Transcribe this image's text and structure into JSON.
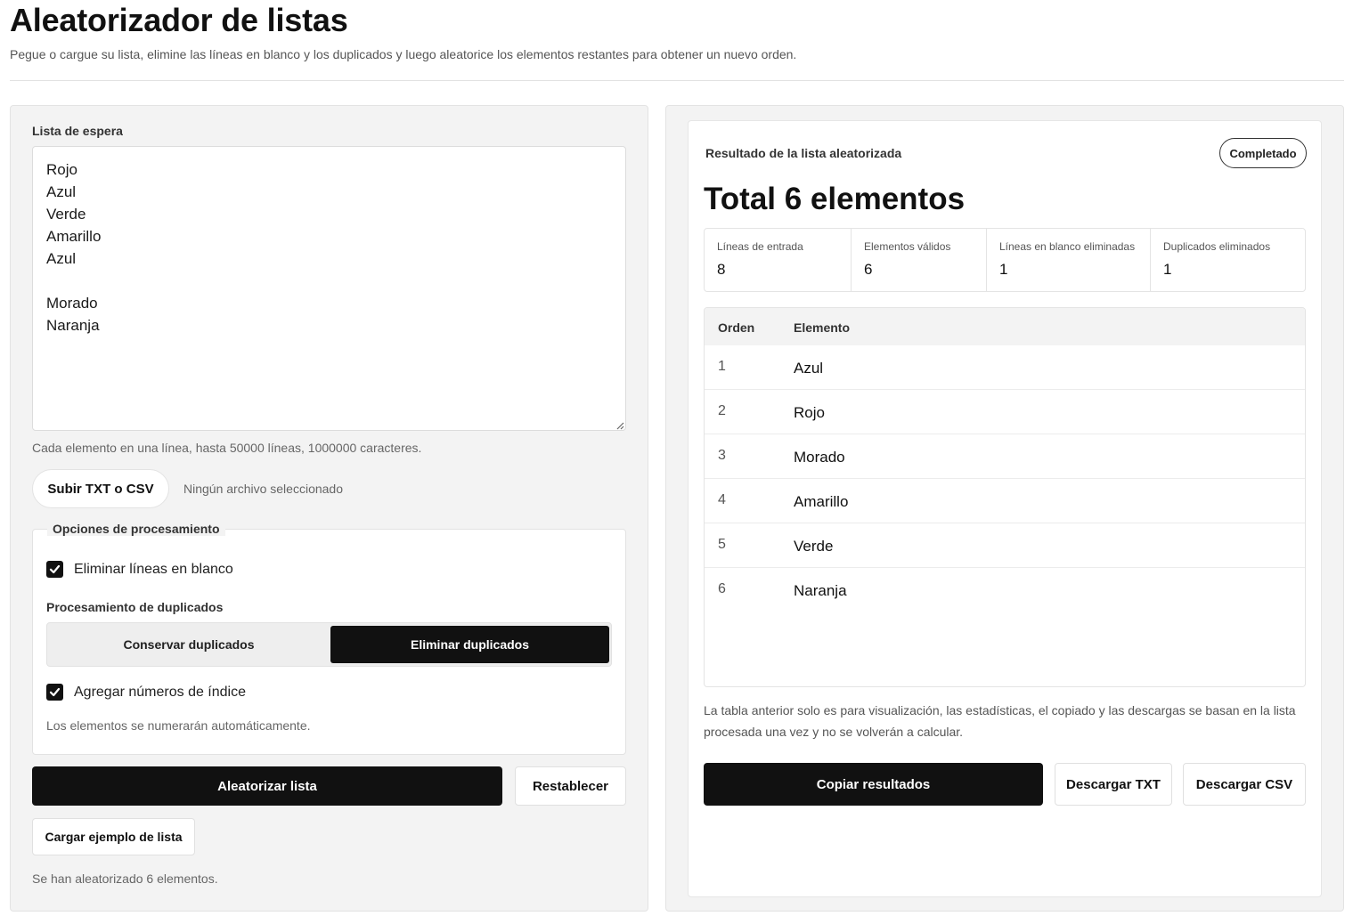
{
  "header": {
    "title": "Aleatorizador de listas",
    "subtitle": "Pegue o cargue su lista, elimine las líneas en blanco y los duplicados y luego aleatorice los elementos restantes para obtener un nuevo orden."
  },
  "input": {
    "label": "Lista de espera",
    "value": "Rojo\nAzul\nVerde\nAmarillo\nAzul\n\nMorado\nNaranja",
    "hint": "Cada elemento en una línea, hasta 50000 líneas, 1000000 caracteres.",
    "upload_label": "Subir TXT o CSV",
    "file_status": "Ningún archivo seleccionado"
  },
  "options": {
    "legend": "Opciones de procesamiento",
    "remove_blank_label": "Eliminar líneas en blanco",
    "remove_blank_checked": true,
    "duplicates_title": "Procesamiento de duplicados",
    "keep_duplicates_label": "Conservar duplicados",
    "remove_duplicates_label": "Eliminar duplicados",
    "selected_duplicate_mode": "Eliminar duplicados",
    "add_index_label": "Agregar números de índice",
    "add_index_checked": true,
    "index_hint": "Los elementos se numerarán automáticamente."
  },
  "actions": {
    "randomize_label": "Aleatorizar lista",
    "reset_label": "Restablecer",
    "load_example_label": "Cargar ejemplo de lista",
    "status": "Se han aleatorizado 6 elementos."
  },
  "result": {
    "title": "Resultado de la lista aleatorizada",
    "badge": "Completado",
    "total": "Total 6 elementos",
    "stats": [
      {
        "label": "Líneas de entrada",
        "value": "8"
      },
      {
        "label": "Elementos válidos",
        "value": "6"
      },
      {
        "label": "Líneas en blanco eliminadas",
        "value": "1"
      },
      {
        "label": "Duplicados eliminados",
        "value": "1"
      }
    ],
    "table": {
      "col_order": "Orden",
      "col_element": "Elemento",
      "rows": [
        {
          "order": "1",
          "element": "Azul"
        },
        {
          "order": "2",
          "element": "Rojo"
        },
        {
          "order": "3",
          "element": "Morado"
        },
        {
          "order": "4",
          "element": "Amarillo"
        },
        {
          "order": "5",
          "element": "Verde"
        },
        {
          "order": "6",
          "element": "Naranja"
        }
      ]
    },
    "note": "La tabla anterior solo es para visualización, las estadísticas, el copiado y las descargas se basan en la lista procesada una vez y no se volverán a calcular.",
    "copy_label": "Copiar resultados",
    "download_txt_label": "Descargar TXT",
    "download_csv_label": "Descargar CSV"
  }
}
